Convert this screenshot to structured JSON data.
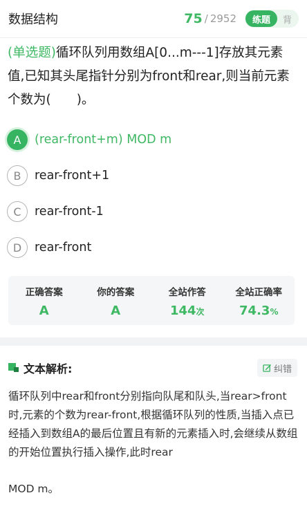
{
  "header": {
    "title": "数据结构",
    "counter_current": "75",
    "counter_sep": "/",
    "counter_total": "2952",
    "mode_practice": "练题",
    "mode_memorize": "背"
  },
  "question": {
    "type": "(单选题)",
    "text": "循环队列用数组A[0...m---1]存放其元素值,已知其头尾指针分别为front和rear,则当前元素个数为(　　)。"
  },
  "options": [
    {
      "letter": "A",
      "text": "(rear-front+m) MOD m",
      "selected": true
    },
    {
      "letter": "B",
      "text": "rear-front+1",
      "selected": false
    },
    {
      "letter": "C",
      "text": "rear-front-1",
      "selected": false
    },
    {
      "letter": "D",
      "text": "rear-front",
      "selected": false
    }
  ],
  "stats": {
    "correct_label": "正确答案",
    "correct_value": "A",
    "yours_label": "你的答案",
    "yours_value": "A",
    "attempts_label": "全站作答",
    "attempts_value": "144",
    "attempts_unit": "次",
    "rate_label": "全站正确率",
    "rate_value": "74.3",
    "rate_unit": "%"
  },
  "analysis": {
    "title": "文本解析:",
    "report_label": "纠错",
    "text": "循环队列中rear和front分别指向队尾和队头,当rear>front时,元素的个数为rear-front,根据循环队列的性质,当插入点已经插入到数组A的最后位置且有新的元素插入时,会继续从数组的开始位置执行插入操作,此时rear",
    "text_end": "MOD m。"
  },
  "colors": {
    "accent": "#37b462",
    "accent_text": "#3fb864"
  }
}
